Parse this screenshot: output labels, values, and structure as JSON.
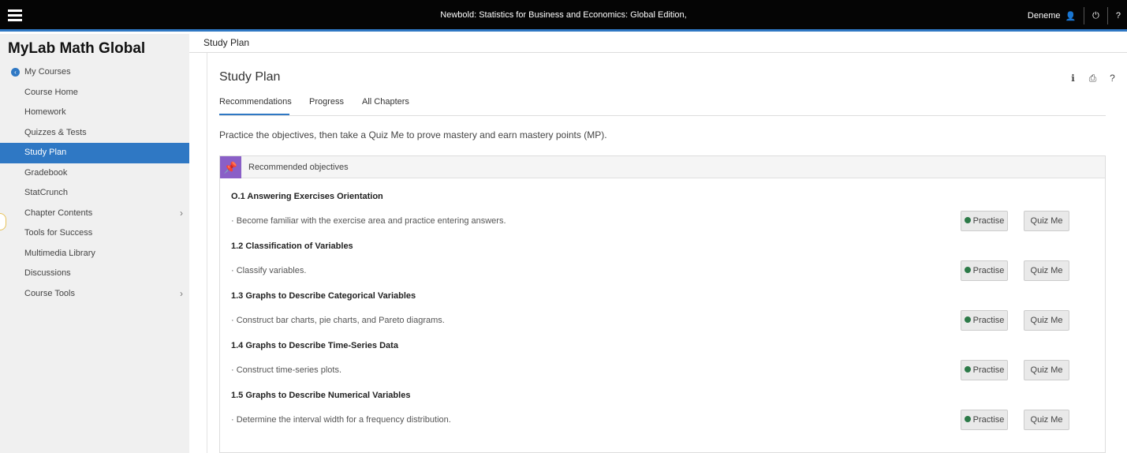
{
  "header": {
    "course_title": "Newbold: Statistics for Business and Economics: Global Edition,",
    "user_name": "Deneme",
    "icons": [
      "menu-icon",
      "user-icon",
      "power-icon",
      "help-icon"
    ]
  },
  "sidebar": {
    "brand": "MyLab Math Global",
    "back_label": "My Courses",
    "items": [
      {
        "label": "Course Home"
      },
      {
        "label": "Homework"
      },
      {
        "label": "Quizzes & Tests"
      },
      {
        "label": "Study Plan",
        "active": true
      },
      {
        "label": "Gradebook"
      },
      {
        "label": "StatCrunch"
      },
      {
        "label": "Chapter Contents",
        "has_submenu": true
      },
      {
        "label": "Tools for Success"
      },
      {
        "label": "Multimedia Library"
      },
      {
        "label": "Discussions"
      },
      {
        "label": "Course Tools",
        "has_submenu": true
      }
    ]
  },
  "breadcrumb": "Study Plan",
  "main": {
    "title": "Study Plan",
    "tools": [
      "info-icon",
      "print-icon",
      "help-icon"
    ],
    "tabs": [
      {
        "label": "Recommendations",
        "active": true
      },
      {
        "label": "Progress"
      },
      {
        "label": "All Chapters"
      }
    ],
    "intro": "Practice the objectives, then take a Quiz Me to prove mastery and earn mastery points (MP).",
    "panel_title": "Recommended objectives",
    "practise_label": "Practise",
    "quiz_label": "Quiz Me",
    "objectives": [
      {
        "title": "O.1 Answering Exercises Orientation",
        "description": "Become familiar with the exercise area and practice entering answers."
      },
      {
        "title": "1.2 Classification of Variables",
        "description": "Classify variables."
      },
      {
        "title": "1.3 Graphs to Describe Categorical Variables",
        "description": "Construct bar charts, pie charts, and Pareto diagrams."
      },
      {
        "title": "1.4 Graphs to Describe Time-Series Data",
        "description": "Construct time-series plots."
      },
      {
        "title": "1.5 Graphs to Describe Numerical Variables",
        "description": "Determine the interval width for a frequency distribution."
      }
    ]
  },
  "colors": {
    "accent": "#2f78c4",
    "topbar": "#050505",
    "practise_dot": "#2c7a48",
    "pin_badge": "#8a5fc7"
  }
}
